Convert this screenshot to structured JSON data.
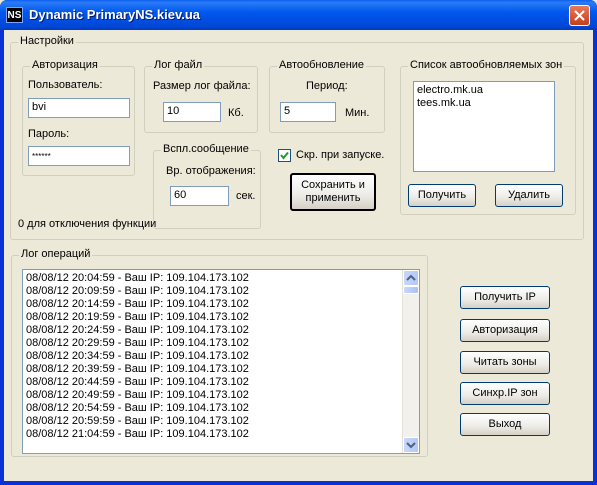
{
  "window": {
    "title": "Dynamic PrimaryNS.kiev.ua",
    "app_icon_text": "NS"
  },
  "settings": {
    "legend": "Настройки",
    "auth": {
      "legend": "Авторизация",
      "user_label": "Пользователь:",
      "user_value": "bvi",
      "password_label": "Пароль:",
      "password_value": "******"
    },
    "logfile": {
      "legend": "Лог файл",
      "size_label": "Размер лог файла:",
      "size_value": "10",
      "unit": "Кб."
    },
    "autoupdate": {
      "legend": "Автообновление",
      "period_label": "Период:",
      "period_value": "5",
      "unit": "Мин."
    },
    "popup": {
      "legend": "Вспл.сообщение",
      "time_label": "Вр. отображения:",
      "time_value": "60",
      "unit": "сек."
    },
    "hide_on_start": {
      "label": "Скр. при запуске.",
      "checked": true
    },
    "save_button": {
      "line1": "Сохранить и",
      "line2": "применить"
    },
    "zero_note": "0 для отключения функции",
    "zones": {
      "legend": "Список автообновляемых зон",
      "items": [
        "electro.mk.ua",
        "tees.mk.ua"
      ],
      "get_button": "Получить",
      "delete_button": "Удалить"
    }
  },
  "log": {
    "legend": "Лог операций",
    "lines": [
      "08/08/12 20:04:59 - Ваш IP: 109.104.173.102",
      "08/08/12 20:09:59 - Ваш IP: 109.104.173.102",
      "08/08/12 20:14:59 - Ваш IP: 109.104.173.102",
      "08/08/12 20:19:59 - Ваш IP: 109.104.173.102",
      "08/08/12 20:24:59 - Ваш IP: 109.104.173.102",
      "08/08/12 20:29:59 - Ваш IP: 109.104.173.102",
      "08/08/12 20:34:59 - Ваш IP: 109.104.173.102",
      "08/08/12 20:39:59 - Ваш IP: 109.104.173.102",
      "08/08/12 20:44:59 - Ваш IP: 109.104.173.102",
      "08/08/12 20:49:59 - Ваш IP: 109.104.173.102",
      "08/08/12 20:54:59 - Ваш IP: 109.104.173.102",
      "08/08/12 20:59:59 - Ваш IP: 109.104.173.102",
      "08/08/12 21:04:59 - Ваш IP: 109.104.173.102"
    ]
  },
  "actions": {
    "get_ip": "Получить IP",
    "authorize": "Авторизация",
    "read_zones": "Читать зоны",
    "sync_ip": "Синхр.IP зон",
    "exit": "Выход"
  },
  "colors": {
    "titlebar": "#0058ee",
    "face": "#ece9d8",
    "close_button": "#e0502b"
  }
}
